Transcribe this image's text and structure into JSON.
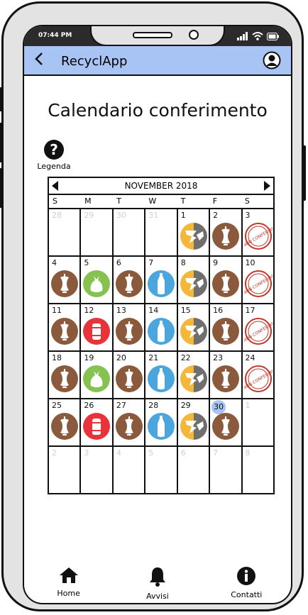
{
  "status": {
    "time": "07:44 PM"
  },
  "appbar": {
    "title": "RecyclApp",
    "back_icon": "back-arrow-icon",
    "profile_icon": "profile-icon"
  },
  "page": {
    "title": "Calendario conferimento"
  },
  "legend": {
    "label": "Legenda",
    "icon": "help-icon"
  },
  "calendar": {
    "month_label": "NOVEMBER 2018",
    "weekdays": [
      "S",
      "M",
      "T",
      "W",
      "T",
      "F",
      "S"
    ],
    "today": "30",
    "colors": {
      "brown": "#8b5a3c",
      "yellow": "#f4b73a",
      "gray": "#6f6f6f",
      "green": "#86c24f",
      "blue": "#4aa6dd",
      "red": "#e8333a",
      "stamp": "#c0392b",
      "highlight": "#a7c4f5"
    },
    "weeks": [
      [
        {
          "day": "28",
          "other": true,
          "bin": null
        },
        {
          "day": "29",
          "other": true,
          "bin": null
        },
        {
          "day": "30",
          "other": true,
          "bin": null
        },
        {
          "day": "31",
          "other": true,
          "bin": null
        },
        {
          "day": "1",
          "bin": "carta-vetro"
        },
        {
          "day": "2",
          "bin": "organico"
        },
        {
          "day": "3",
          "bin": "non-conferire"
        }
      ],
      [
        {
          "day": "4",
          "bin": "organico"
        },
        {
          "day": "5",
          "bin": "indifferenziato"
        },
        {
          "day": "6",
          "bin": "organico"
        },
        {
          "day": "7",
          "bin": "plastica"
        },
        {
          "day": "8",
          "bin": "carta-vetro"
        },
        {
          "day": "9",
          "bin": "organico"
        },
        {
          "day": "10",
          "bin": "non-conferire"
        }
      ],
      [
        {
          "day": "11",
          "bin": "organico"
        },
        {
          "day": "12",
          "bin": "metalli"
        },
        {
          "day": "13",
          "bin": "organico"
        },
        {
          "day": "14",
          "bin": "plastica"
        },
        {
          "day": "15",
          "bin": "carta-vetro"
        },
        {
          "day": "16",
          "bin": "organico"
        },
        {
          "day": "17",
          "bin": "non-conferire"
        }
      ],
      [
        {
          "day": "18",
          "bin": "organico"
        },
        {
          "day": "19",
          "bin": "indifferenziato"
        },
        {
          "day": "20",
          "bin": "organico"
        },
        {
          "day": "21",
          "bin": "plastica"
        },
        {
          "day": "22",
          "bin": "carta-vetro"
        },
        {
          "day": "23",
          "bin": "organico"
        },
        {
          "day": "24",
          "bin": "non-conferire"
        }
      ],
      [
        {
          "day": "25",
          "bin": "organico"
        },
        {
          "day": "26",
          "bin": "metalli"
        },
        {
          "day": "27",
          "bin": "organico"
        },
        {
          "day": "28",
          "bin": "plastica"
        },
        {
          "day": "29",
          "bin": "carta-vetro"
        },
        {
          "day": "30",
          "bin": "organico"
        },
        {
          "day": "1",
          "other": true,
          "bin": null
        }
      ],
      [
        {
          "day": "2",
          "other": true,
          "bin": null
        },
        {
          "day": "3",
          "other": true,
          "bin": null
        },
        {
          "day": "4",
          "other": true,
          "bin": null
        },
        {
          "day": "5",
          "other": true,
          "bin": null
        },
        {
          "day": "6",
          "other": true,
          "bin": null
        },
        {
          "day": "7",
          "other": true,
          "bin": null
        },
        {
          "day": "8",
          "other": true,
          "bin": null
        }
      ]
    ],
    "stamp_text": "NON CONFERIRE"
  },
  "nav": [
    {
      "label": "Home",
      "icon": "home-icon"
    },
    {
      "label": "Avvisi",
      "icon": "bell-icon"
    },
    {
      "label": "Contatti",
      "icon": "info-icon"
    }
  ]
}
